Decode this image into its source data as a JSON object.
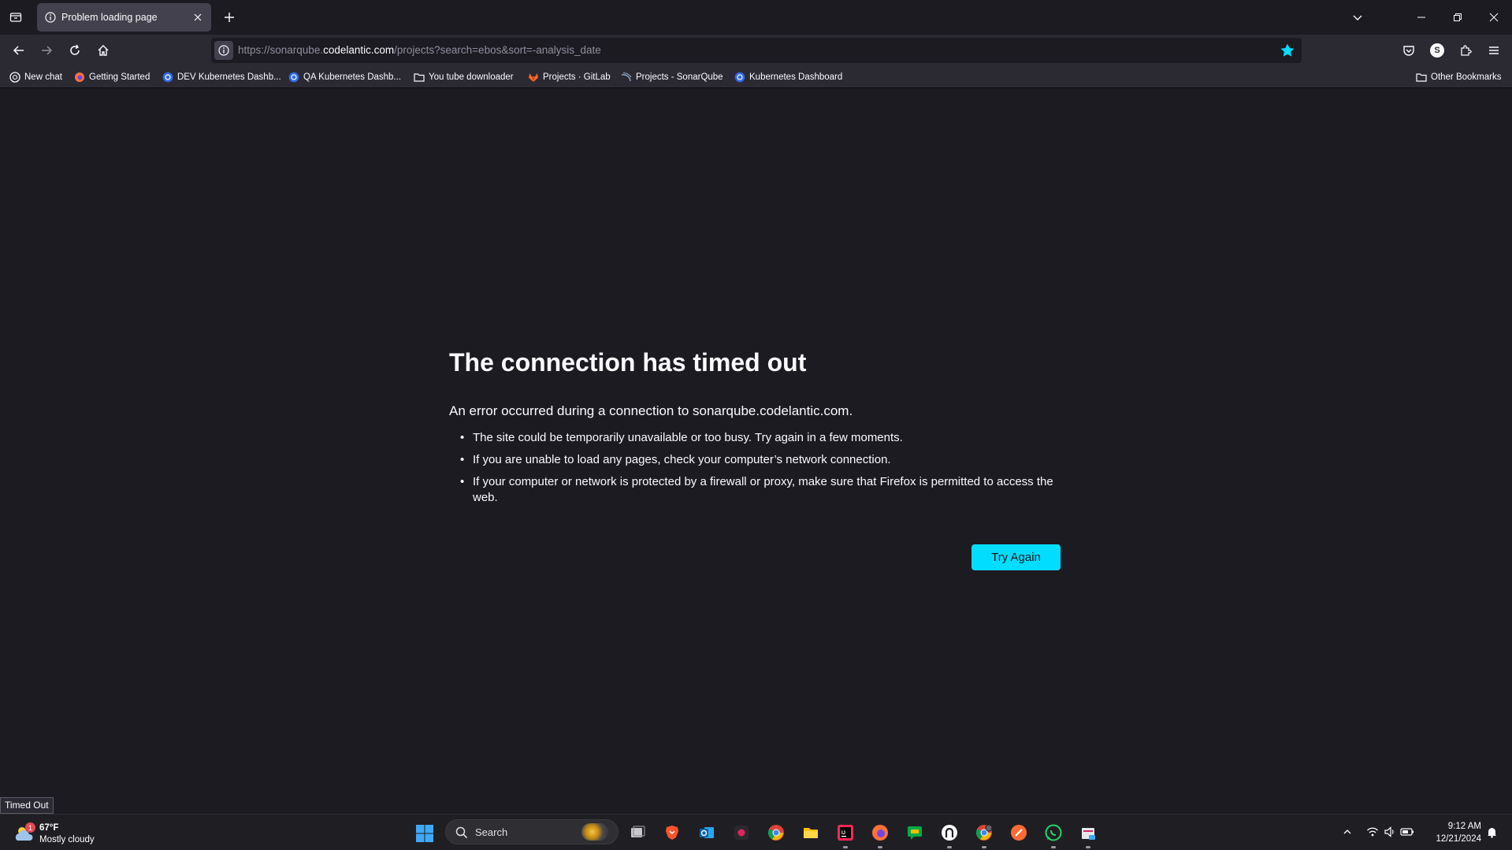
{
  "browser": {
    "tab": {
      "title": "Problem loading page"
    },
    "url": {
      "prefix": "https://sonarqube.",
      "host": "codelantic.com",
      "path": "/projects?search=ebos&sort=-analysis_date"
    },
    "profile_initial": "S"
  },
  "bookmarks": {
    "items": [
      {
        "label": "New chat",
        "icon": "chat-icon"
      },
      {
        "label": "Getting Started",
        "icon": "firefox-icon"
      },
      {
        "label": "DEV Kubernetes Dashb...",
        "icon": "kubernetes-icon"
      },
      {
        "label": "QA Kubernetes Dashb...",
        "icon": "kubernetes-icon"
      },
      {
        "label": "You tube downloader",
        "icon": "folder-icon"
      },
      {
        "label": "Projects · GitLab",
        "icon": "gitlab-icon"
      },
      {
        "label": "Projects - SonarQube",
        "icon": "sonarqube-icon"
      },
      {
        "label": "Kubernetes Dashboard",
        "icon": "kubernetes-icon"
      }
    ],
    "other": "Other Bookmarks"
  },
  "error": {
    "title": "The connection has timed out",
    "description": "An error occurred during a connection to sonarqube.codelantic.com.",
    "bullets": [
      "The site could be temporarily unavailable or too busy. Try again in a few moments.",
      "If you are unable to load any pages, check your computer’s network connection.",
      "If your computer or network is protected by a firewall or proxy, make sure that Firefox is permitted to access the web."
    ],
    "button": "Try Again"
  },
  "status_text": "Timed Out",
  "taskbar": {
    "weather": {
      "badge": "1",
      "temp": "67°F",
      "desc": "Mostly cloudy"
    },
    "search_placeholder": "Search",
    "apps": [
      "task-view",
      "brave",
      "outlook",
      "screen-recorder",
      "chrome",
      "file-explorer",
      "intellij",
      "firefox",
      "chat",
      "anydesk",
      "chrome-profile",
      "postman",
      "whatsapp",
      "snipping-tool"
    ],
    "clock": {
      "time": "9:12 AM",
      "date": "12/21/2024"
    }
  },
  "colors": {
    "accent": "#00ddff",
    "page_bg": "#1c1b22",
    "toolbar_bg": "#2b2a33",
    "star": "#00ddff"
  }
}
